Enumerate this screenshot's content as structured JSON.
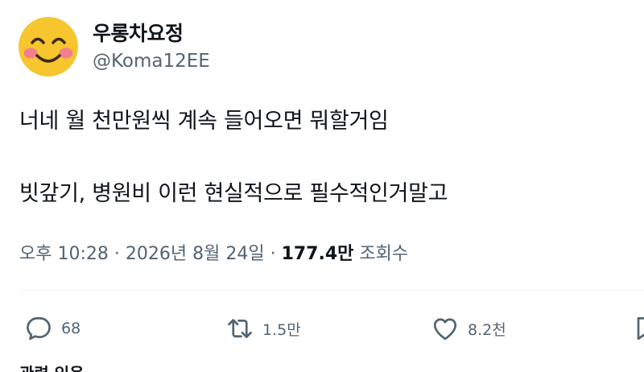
{
  "user": {
    "display_name": "우롱차요정",
    "handle": "@Koma12EE",
    "avatar_icon": "smiling-face-with-blush-icon"
  },
  "tweet": {
    "line1": "너네 월 천만원씩 계속 들어오면 뭐할거임",
    "line2": "빗갚기, 병원비 이런 현실적으로 필수적인거말고"
  },
  "meta": {
    "time": "오후 10:28",
    "date": "2026년 8월 24일",
    "separator": "·",
    "views_count": "177.4만",
    "views_label": "조회수"
  },
  "actions": {
    "reply_count": "68",
    "retweet_count": "1.5만",
    "like_count": "8.2천"
  },
  "footer": {
    "related_label": "관련 있음"
  },
  "colors": {
    "text": "#0f1419",
    "secondary": "#536471",
    "divider": "#eff3f4",
    "avatar_face": "#f7c52e",
    "avatar_blush": "#f37f8e"
  }
}
